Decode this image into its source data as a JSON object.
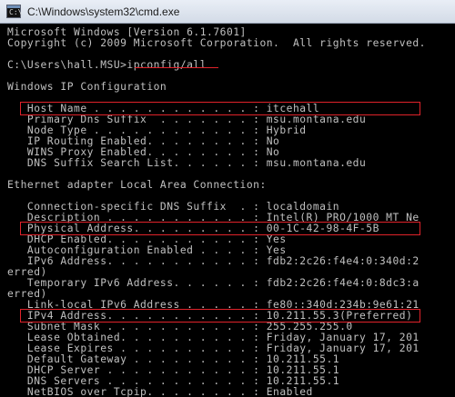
{
  "window": {
    "title": "C:\\Windows\\system32\\cmd.exe",
    "icon": "cmd-icon",
    "icon_glyph": "C:\\"
  },
  "console": {
    "lines": [
      "Microsoft Windows [Version 6.1.7601]",
      "Copyright (c) 2009 Microsoft Corporation.  All rights reserved.",
      "",
      "C:\\Users\\hall.MSU>ipconfig/all",
      "",
      "Windows IP Configuration",
      "",
      "   Host Name . . . . . . . . . . . . : itcehall",
      "   Primary Dns Suffix  . . . . . . . : msu.montana.edu",
      "   Node Type . . . . . . . . . . . . : Hybrid",
      "   IP Routing Enabled. . . . . . . . : No",
      "   WINS Proxy Enabled. . . . . . . . : No",
      "   DNS Suffix Search List. . . . . . : msu.montana.edu",
      "",
      "Ethernet adapter Local Area Connection:",
      "",
      "   Connection-specific DNS Suffix  . : localdomain",
      "   Description . . . . . . . . . . . : Intel(R) PRO/1000 MT Ne",
      "   Physical Address. . . . . . . . . : 00-1C-42-98-4F-5B",
      "   DHCP Enabled. . . . . . . . . . . : Yes",
      "   Autoconfiguration Enabled . . . . : Yes",
      "   IPv6 Address. . . . . . . . . . . : fdb2:2c26:f4e4:0:340d:2",
      "erred)",
      "   Temporary IPv6 Address. . . . . . : fdb2:2c26:f4e4:0:8dc3:a",
      "erred)",
      "   Link-local IPv6 Address . . . . . : fe80::340d:234b:9e61:21",
      "   IPv4 Address. . . . . . . . . . . : 10.211.55.3(Preferred)",
      "   Subnet Mask . . . . . . . . . . . : 255.255.255.0",
      "   Lease Obtained. . . . . . . . . . : Friday, January 17, 201",
      "   Lease Expires . . . . . . . . . . : Friday, January 17, 201",
      "   Default Gateway . . . . . . . . . : 10.211.55.1",
      "   DHCP Server . . . . . . . . . . . : 10.211.55.1",
      "   DNS Servers . . . . . . . . . . . : 10.211.55.1",
      "   NetBIOS over Tcpip. . . . . . . . : Enabled"
    ]
  },
  "highlights": {
    "color": "#e0222a",
    "boxes": [
      "host-name",
      "physical-address",
      "ipv4-address"
    ],
    "underlined_command": "ipconfig/all"
  }
}
